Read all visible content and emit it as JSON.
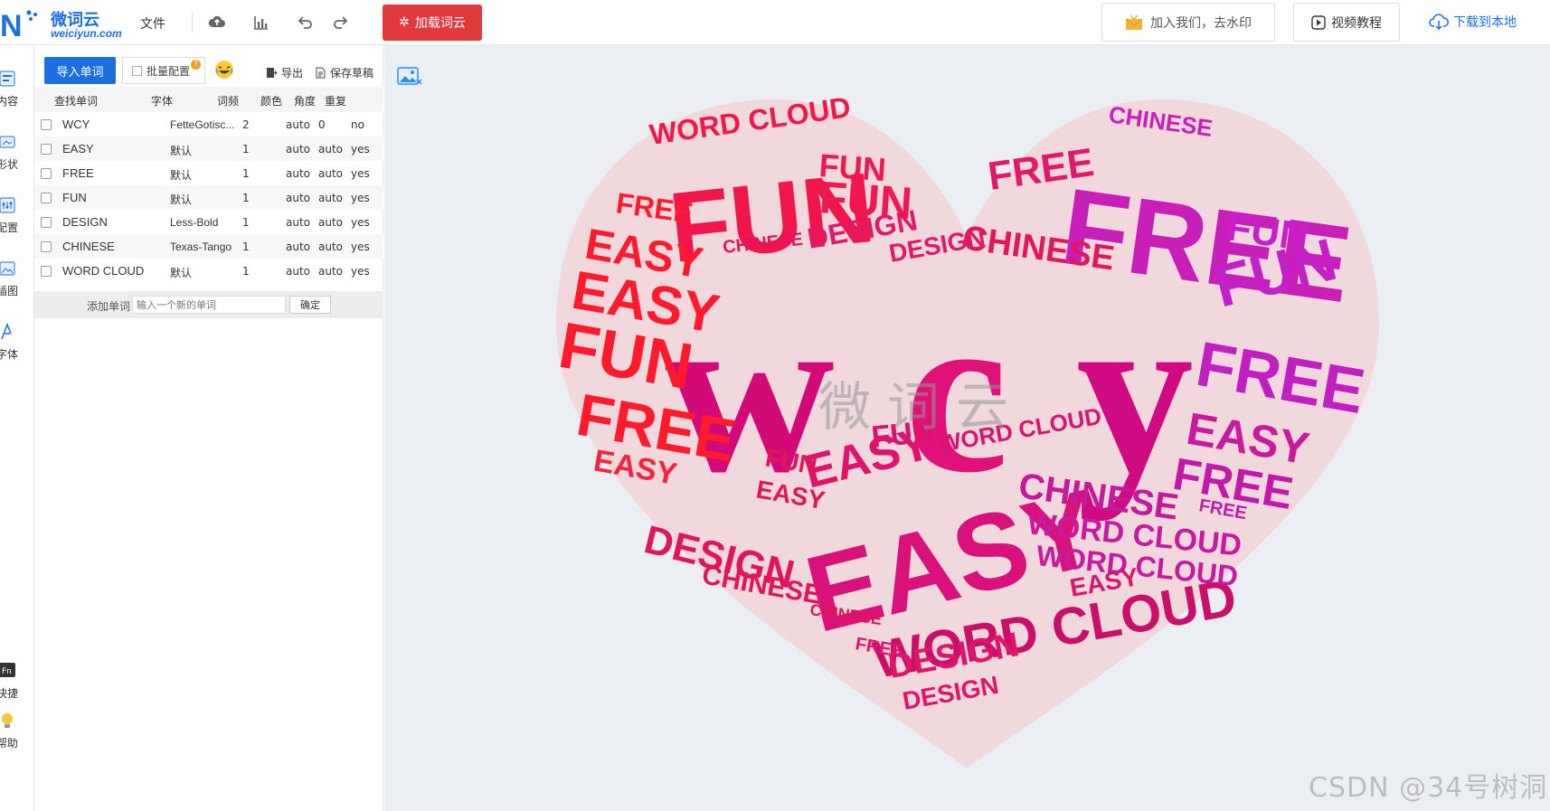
{
  "brand": {
    "name_cn": "微词云",
    "name_en": "weiciyun.com"
  },
  "toolbar": {
    "file_label": "文件",
    "load_label": "加载词云",
    "join_label": "加入我们，去水印",
    "video_label": "视频教程",
    "download_label": "下载到本地"
  },
  "rail": [
    {
      "label": "内容",
      "icon": "content-icon"
    },
    {
      "label": "形状",
      "icon": "shape-icon"
    },
    {
      "label": "配置",
      "icon": "config-icon"
    },
    {
      "label": "插图",
      "icon": "image-icon"
    },
    {
      "label": "字体",
      "icon": "font-icon"
    },
    {
      "label": "快捷",
      "icon": "shortcut-icon"
    },
    {
      "label": "帮助",
      "icon": "help-bulb-icon"
    }
  ],
  "panel": {
    "import_label": "导入单词",
    "batch_label": "批量配置",
    "export_label": "导出",
    "draft_label": "保存草稿",
    "columns": [
      "查找单词",
      "字体",
      "词频",
      "颜色",
      "角度",
      "重复"
    ],
    "rows": [
      {
        "word": "WCY",
        "font": "FetteGotisc...",
        "freq": "2",
        "color": "auto",
        "angle": "0",
        "repeat": "no"
      },
      {
        "word": "EASY",
        "font": "默认",
        "freq": "1",
        "color": "auto",
        "angle": "auto",
        "repeat": "yes"
      },
      {
        "word": "FREE",
        "font": "默认",
        "freq": "1",
        "color": "auto",
        "angle": "auto",
        "repeat": "yes"
      },
      {
        "word": "FUN",
        "font": "默认",
        "freq": "1",
        "color": "auto",
        "angle": "auto",
        "repeat": "yes"
      },
      {
        "word": "DESIGN",
        "font": "Less-Bold",
        "freq": "1",
        "color": "auto",
        "angle": "auto",
        "repeat": "yes"
      },
      {
        "word": "CHINESE",
        "font": "Texas-Tango",
        "freq": "1",
        "color": "auto",
        "angle": "auto",
        "repeat": "yes"
      },
      {
        "word": "WORD CLOUD",
        "font": "默认",
        "freq": "1",
        "color": "auto",
        "angle": "auto",
        "repeat": "yes"
      }
    ],
    "add_label": "添加单词",
    "add_placeholder": "输入一个新的单词",
    "confirm_label": "确定"
  },
  "cloud": {
    "center_word": "wcy",
    "watermark_cn": "微词云",
    "footer_watermark": "CSDN @34号树洞",
    "colors": [
      "#ff1a2e",
      "#e8156a",
      "#d10a8a",
      "#c21fc8",
      "#f0306a"
    ]
  }
}
